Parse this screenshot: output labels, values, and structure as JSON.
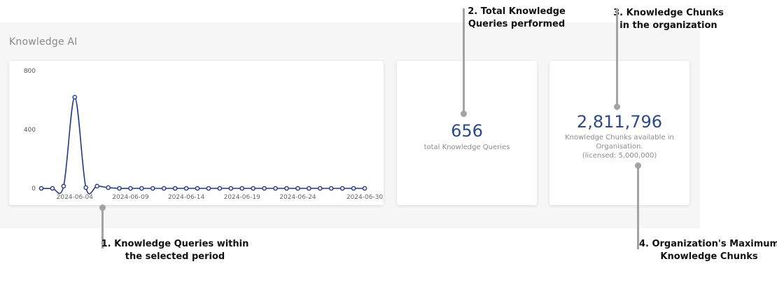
{
  "panel": {
    "title": "Knowledge AI"
  },
  "queries_card": {
    "value": "656",
    "label": "total Knowledge Queries"
  },
  "chunks_card": {
    "value": "2,811,796",
    "label_line1": "Knowledge Chunks available in",
    "label_line2": "Organisation.",
    "label_line3": "(licensed: 5,000,000)"
  },
  "annotations": {
    "a1_line1": "1. Knowledge Queries within",
    "a1_line2": "the selected period",
    "a2_line1": "2. Total Knowledge",
    "a2_line2": "Queries performed",
    "a3_line1": "3. Knowledge Chunks",
    "a3_line2": "in the organization",
    "a4_line1": "4. Organization's Maximum",
    "a4_line2": "Knowledge Chunks"
  },
  "chart_data": {
    "type": "line",
    "title": "",
    "xlabel": "",
    "ylabel": "",
    "ylim": [
      0,
      800
    ],
    "y_ticks": [
      "0",
      "400",
      "800"
    ],
    "x_tick_labels": [
      "2024-06-04",
      "2024-06-09",
      "2024-06-14",
      "2024-06-19",
      "2024-06-24",
      "2024-06-30"
    ],
    "x": [
      "2024-06-01",
      "2024-06-02",
      "2024-06-03",
      "2024-06-04",
      "2024-06-05",
      "2024-06-06",
      "2024-06-07",
      "2024-06-08",
      "2024-06-09",
      "2024-06-10",
      "2024-06-11",
      "2024-06-12",
      "2024-06-13",
      "2024-06-14",
      "2024-06-15",
      "2024-06-16",
      "2024-06-17",
      "2024-06-18",
      "2024-06-19",
      "2024-06-20",
      "2024-06-21",
      "2024-06-22",
      "2024-06-23",
      "2024-06-24",
      "2024-06-25",
      "2024-06-26",
      "2024-06-27",
      "2024-06-28",
      "2024-06-29",
      "2024-06-30"
    ],
    "series": [
      {
        "values": [
          0,
          0,
          15,
          620,
          5,
          15,
          5,
          0,
          0,
          0,
          0,
          0,
          0,
          0,
          0,
          0,
          0,
          0,
          0,
          0,
          0,
          0,
          0,
          0,
          0,
          0,
          0,
          0,
          0,
          0
        ]
      }
    ],
    "color": "#1f3a8a",
    "grid": false
  }
}
